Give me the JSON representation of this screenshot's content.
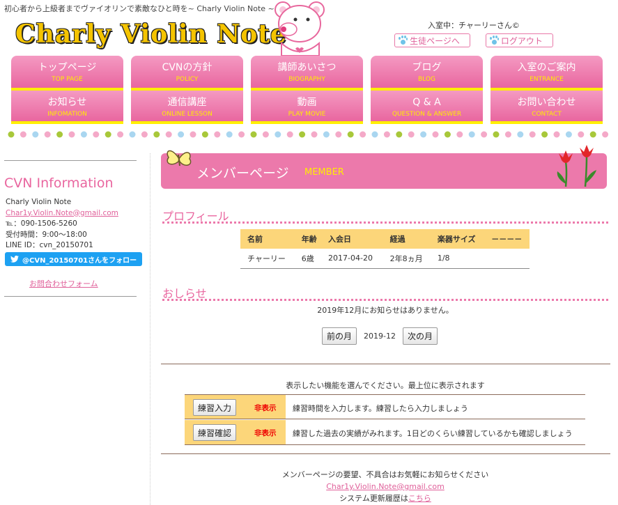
{
  "header": {
    "tagline": "初心者から上級者までヴァイオリンで素敵なひと時を~ Charly Violin Note ~",
    "logo_text": "Charly Violin Note",
    "user_status": "入室中：チャーリーさん©",
    "student_page_label": "生徒ページへ",
    "logout_label": "ログアウト"
  },
  "nav": [
    {
      "jp": "トップページ",
      "en": "TOP PAGE"
    },
    {
      "jp": "CVNの方針",
      "en": "POLICY"
    },
    {
      "jp": "講師あいさつ",
      "en": "BIOGRAPHY"
    },
    {
      "jp": "ブログ",
      "en": "BLOG"
    },
    {
      "jp": "入室のご案内",
      "en": "ENTRANCE"
    },
    {
      "jp": "お知らせ",
      "en": "INFOMATION"
    },
    {
      "jp": "通信講座",
      "en": "ONLINE LESSON"
    },
    {
      "jp": "動画",
      "en": "PLAY MOVIE"
    },
    {
      "jp": "Q & A",
      "en": "QUESTION & ANSWER"
    },
    {
      "jp": "お問い合わせ",
      "en": "CONTACT"
    }
  ],
  "sidebar": {
    "title": "CVN Information",
    "name": "Charly Violin Note",
    "email": "Char1y.Violin.Note@gmail.com",
    "tel": "℡：090-1506-5260",
    "hours": "受付時間：9:00～18:00",
    "line_id": "LINE ID：cvn_20150701",
    "twitter_label": "@CVN_20150701さんをフォロー",
    "contact_form_label": "お問合わせフォーム"
  },
  "banner": {
    "title": "メンバーページ",
    "subtitle": "MEMBER"
  },
  "profile": {
    "heading": "プロフィール",
    "columns": [
      "名前",
      "年齢",
      "入会日",
      "経過",
      "楽器サイズ",
      "－－－－"
    ],
    "row": [
      "チャーリー",
      "6歳",
      "2017-04-20",
      "2年8ヵ月",
      "1/8",
      ""
    ]
  },
  "news": {
    "heading": "おしらせ",
    "message": "2019年12月にお知らせはありません。",
    "prev_label": "前の月",
    "current_month": "2019-12",
    "next_label": "次の月"
  },
  "features": {
    "intro": "表示したい機能を選んでください。最上位に表示されます",
    "items": [
      {
        "button": "練習入力",
        "status": "非表示",
        "desc": "練習時間を入力します。練習したら入力しましょう"
      },
      {
        "button": "練習確認",
        "status": "非表示",
        "desc": "練習した過去の実績がみれます。1日どのくらい練習しているかも確認しましょう"
      }
    ]
  },
  "footer": {
    "line1": "メンバーページの要望、不具合はお気軽にお知らせください",
    "email": "Char1y.Violin.Note@gmail.com",
    "history_text": "システム更新履歴は",
    "history_link": "こちら"
  },
  "colors": {
    "pink": "#ec79ab",
    "yellow": "#ffee00",
    "gold_logo": "#f5c400",
    "table_header": "#fcd67a",
    "twitter": "#1da1f2"
  }
}
